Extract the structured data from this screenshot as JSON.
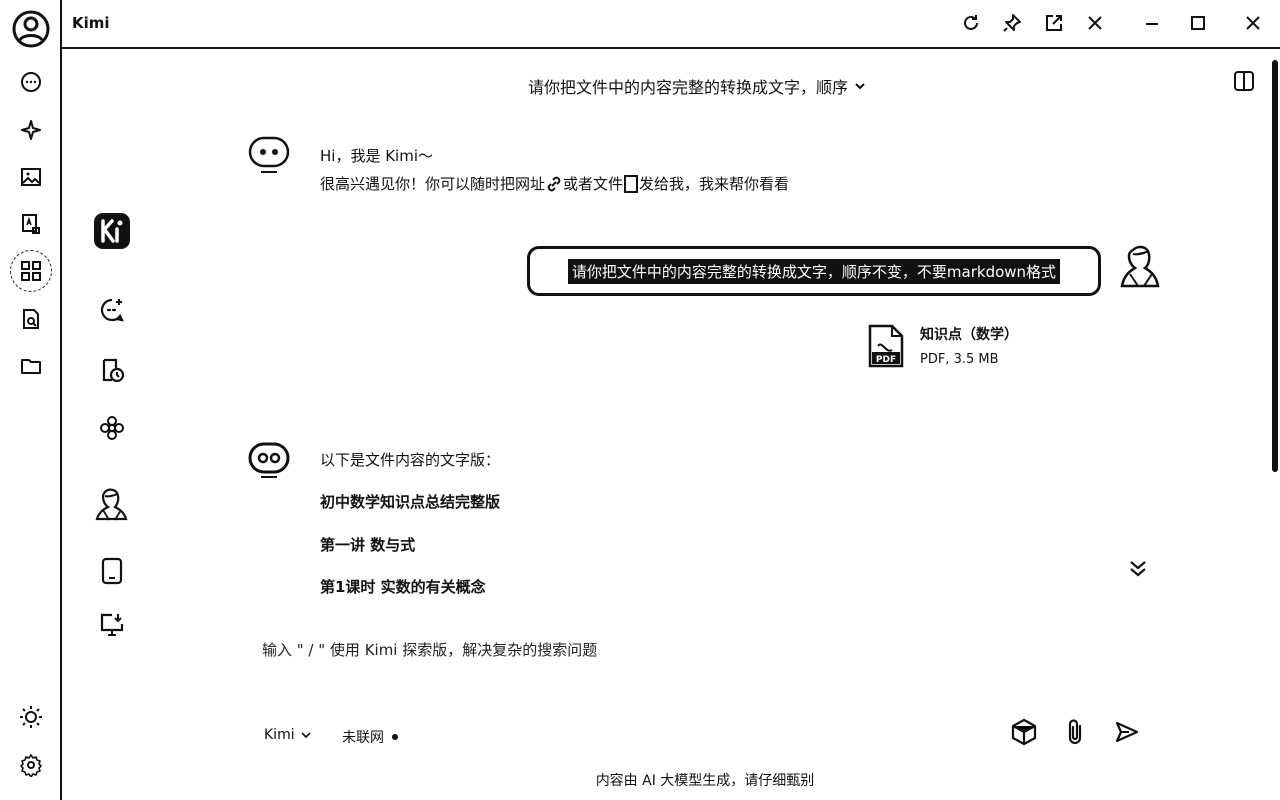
{
  "app": {
    "title": "Kimi"
  },
  "rail": {
    "icons": [
      "user-avatar-icon",
      "chat-bubble-icon",
      "sparkle-icon",
      "image-icon",
      "translate-icon",
      "apps-grid-icon",
      "doc-search-icon",
      "folder-icon",
      "sun-icon",
      "gear-icon"
    ]
  },
  "titlebar": {
    "icons": [
      "refresh-icon",
      "pin-icon",
      "popout-icon",
      "close-panel-icon",
      "minimize-icon",
      "maximize-icon",
      "close-window-icon"
    ]
  },
  "chat": {
    "title": "请你把文件中的内容完整的转换成文字，顺序",
    "greeting_line1": "Hi，我是 Kimi～",
    "greeting_line2_a": "很高兴遇见你！你可以随时把网址",
    "greeting_line2_b": "或者文件",
    "greeting_line2_c": "发给我，我来帮你看看",
    "user_message": "请你把文件中的内容完整的转换成文字，顺序不变，不要markdown格式",
    "file": {
      "name": "知识点（数学）",
      "meta": "PDF, 3.5 MB",
      "badge": "PDF"
    },
    "response": {
      "intro": "以下是文件内容的文字版：",
      "lines": [
        "初中数学知识点总结完整版",
        "第一讲 数与式",
        "第1课时 实数的有关概念"
      ]
    }
  },
  "composer": {
    "placeholder": "输入 \" / \" 使用 Kimi 探索版，解决复杂的搜索问题",
    "model": "Kimi",
    "network": "未联网"
  },
  "footer": {
    "note": "内容由 AI 大模型生成，请仔细甄别"
  },
  "colors": {
    "ink": "#111111",
    "background": "#ffffff"
  }
}
